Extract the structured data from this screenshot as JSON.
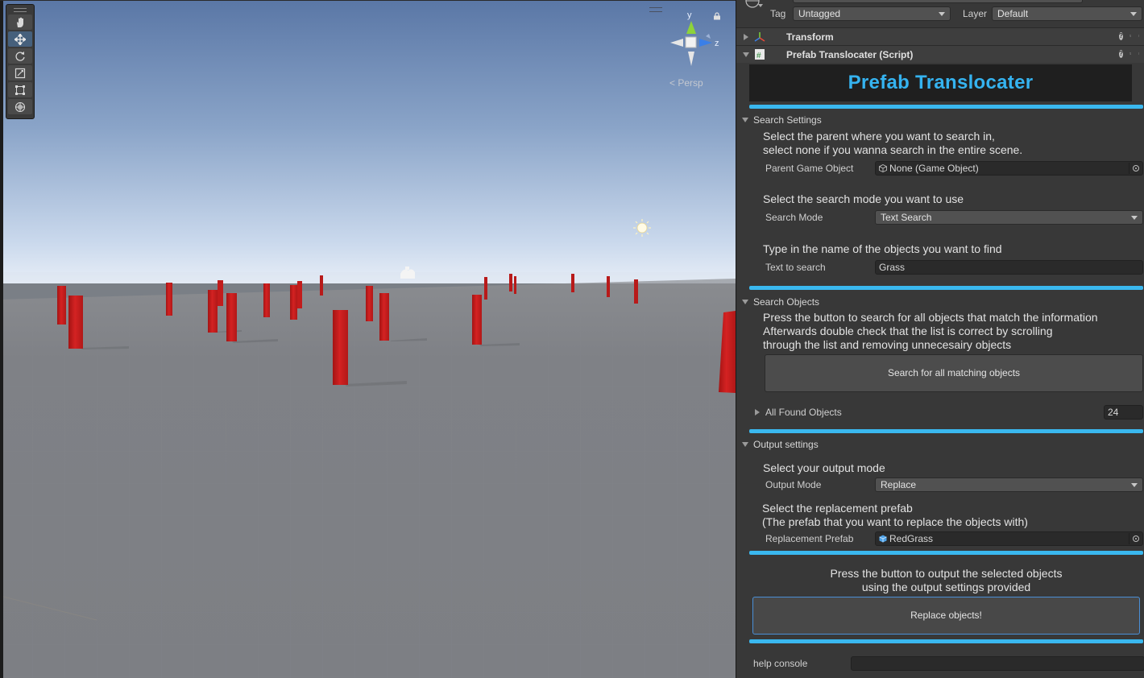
{
  "scene": {
    "camera_mode": "Persp",
    "gizmo": {
      "y": "y",
      "z": "z"
    },
    "tools": [
      "hand-tool",
      "move-tool",
      "rotate-tool",
      "scale-tool",
      "rect-tool",
      "transform-tool"
    ],
    "active_tool": "move-tool",
    "colors": {
      "sky_top": "#5a7aa8",
      "sky_horizon": "#dce7f4",
      "ground": "#7f8186",
      "pillar": "#c91e1e"
    }
  },
  "inspector": {
    "tag": {
      "label": "Tag",
      "value": "Untagged"
    },
    "layer": {
      "label": "Layer",
      "value": "Default"
    },
    "components": {
      "transform": {
        "name": "Transform"
      },
      "script": {
        "name": "Prefab Translocater (Script)"
      }
    },
    "banner": {
      "title": "Prefab Translocater",
      "color": "#35b3f0"
    },
    "search_settings": {
      "title": "Search Settings",
      "help1": "Select the parent where you want to search in,",
      "help2": "select none if you wanna search in the entire scene.",
      "parent_label": "Parent Game Object",
      "parent_value": "None (Game Object)",
      "mode_help": "Select the search mode you want to use",
      "mode_label": "Search Mode",
      "mode_value": "Text Search",
      "text_help": "Type in the name of the objects you want to find",
      "text_label": "Text  to search",
      "text_value": "Grass"
    },
    "search_objects": {
      "title": "Search Objects",
      "help1": "Press the button to search for all objects that match the information",
      "help2": "Afterwards double check that the list is correct by scrolling",
      "help3": "through the list and removing unnecesairy objects",
      "button": "Search for all matching objects",
      "found_label": "All Found Objects",
      "found_count": "24"
    },
    "output_settings": {
      "title": "Output settings",
      "mode_help": "Select your output mode",
      "mode_label": "Output Mode",
      "mode_value": "Replace",
      "prefab_help1": "Select the replacement prefab",
      "prefab_help2": "(The prefab that you want to replace the objects with)",
      "prefab_label": "Replacement Prefab",
      "prefab_value": "RedGrass",
      "output_help1": "Press the button to output the selected objects",
      "output_help2": "using the output settings provided",
      "output_button": "Replace objects!"
    },
    "console": {
      "label": "help console",
      "value": ""
    }
  }
}
